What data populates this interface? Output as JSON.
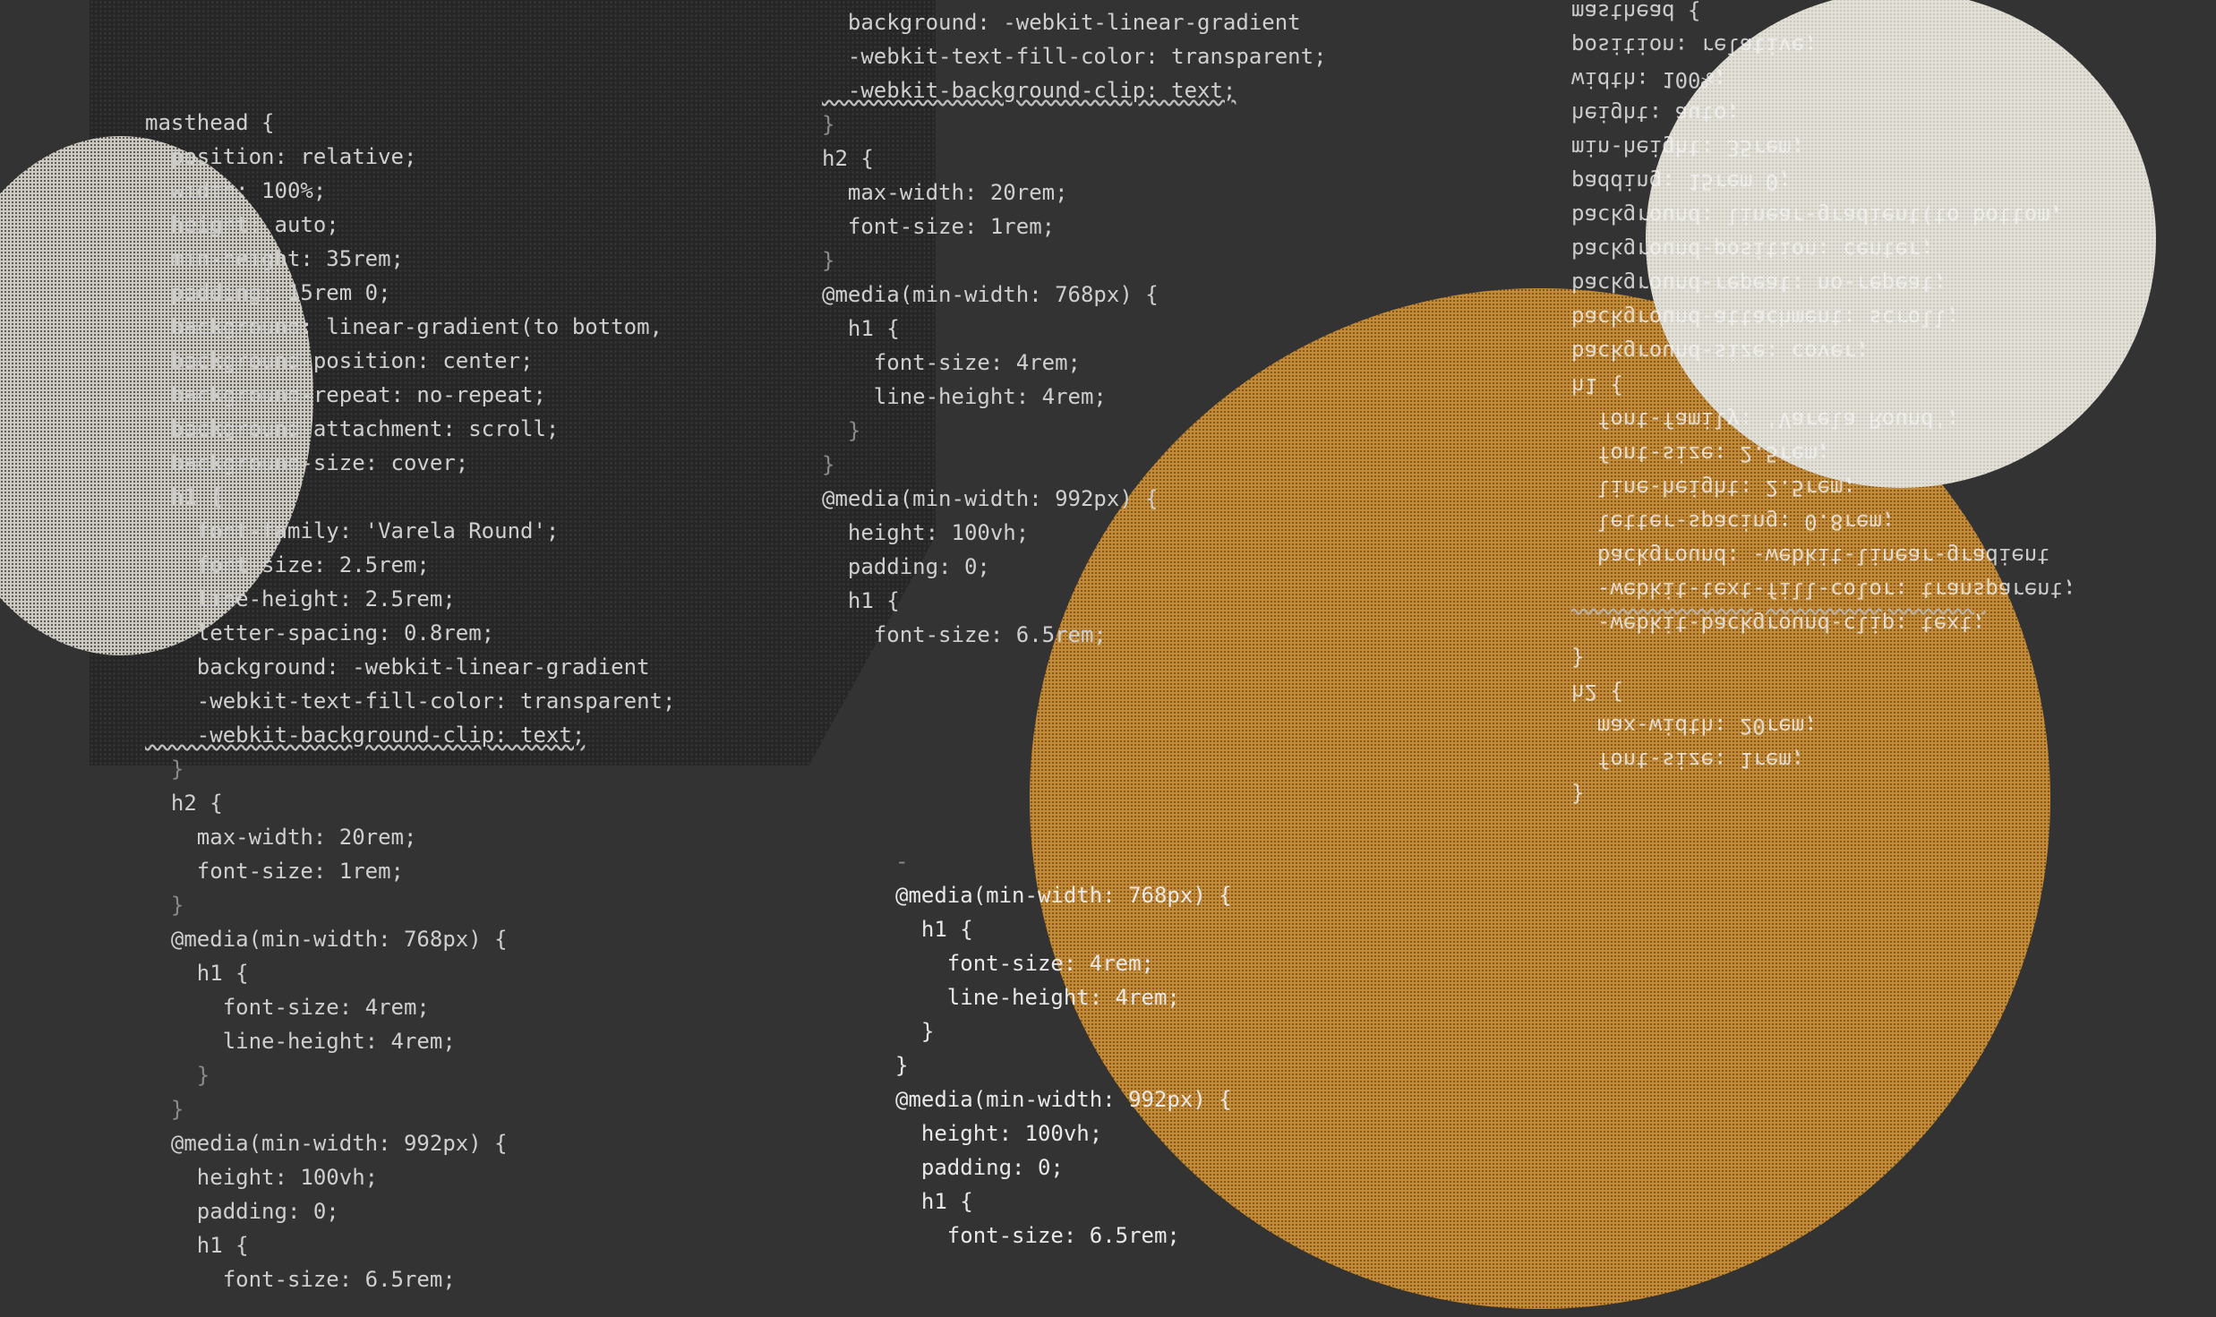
{
  "colors": {
    "background": "#333333",
    "dark_panel": "#262626",
    "orange_circle": "#c48a35",
    "light_circle": "#e2dfd6",
    "code_text": "#cfcfcf"
  },
  "block_left": [
    "masthead {",
    "  position: relative;",
    "  width: 100%;",
    "  height: auto;",
    "  min-height: 35rem;",
    "  padding: 15rem 0;",
    "  background: linear-gradient(to bottom,",
    "  background-position: center;",
    "  background-repeat: no-repeat;",
    "  background-attachment: scroll;",
    "  background-size: cover;",
    "  h1 {",
    "    font-family: 'Varela Round';",
    "    font-size: 2.5rem;",
    "    line-height: 2.5rem;",
    "    letter-spacing: 0.8rem;",
    "    background: -webkit-linear-gradient",
    "    -webkit-text-fill-color: transparent;",
    "    -webkit-background-clip: text;",
    "  }",
    "  h2 {",
    "    max-width: 20rem;",
    "    font-size: 1rem;",
    "  }",
    "  @media(min-width: 768px) {",
    "    h1 {",
    "      font-size: 4rem;",
    "      line-height: 4rem;",
    "    }",
    "  }",
    "  @media(min-width: 992px) {",
    "    height: 100vh;",
    "    padding: 0;",
    "    h1 {",
    "      font-size: 6.5rem;"
  ],
  "block_middle_top": [
    "  background: -webkit-linear-gradient",
    "  -webkit-text-fill-color: transparent;",
    "  -webkit-background-clip: text;",
    "}",
    "h2 {",
    "  max-width: 20rem;",
    "  font-size: 1rem;",
    "}",
    "@media(min-width: 768px) {",
    "  h1 {",
    "    font-size: 4rem;",
    "    line-height: 4rem;",
    "  }",
    "}",
    "@media(min-width: 992px) {",
    "  height: 100vh;",
    "  padding: 0;",
    "  h1 {",
    "    font-size: 6.5rem;"
  ],
  "block_middle_bottom": [
    "-",
    "@media(min-width: 768px) {",
    "  h1 {",
    "    font-size: 4rem;",
    "    line-height: 4rem;",
    "  }",
    "}",
    "@media(min-width: 992px) {",
    "  height: 100vh;",
    "  padding: 0;",
    "  h1 {",
    "    font-size: 6.5rem;"
  ],
  "block_right_mirrored": [
    "}",
    "  font-size: 1rem;",
    "  max-width: 20rem;",
    "h2 {",
    "}",
    "  -webkit-background-clip: text;",
    "  -webkit-text-fill-color: transparent;",
    "  background: -webkit-linear-gradient",
    "  letter-spacing: 0.8rem;",
    "  line-height: 2.5rem;",
    "  font-size: 2.5rem;",
    "  font-family: 'Varela Round';",
    "h1 {",
    "background-size: cover;",
    "background-attachment: scroll;",
    "background-repeat: no-repeat;",
    "background-position: center;",
    "background: linear-gradient(to bottom,",
    "padding: 15rem 0;",
    "min-height: 35rem;",
    "height: auto;",
    "width: 100%;",
    "position: relative;",
    "masthead {"
  ]
}
